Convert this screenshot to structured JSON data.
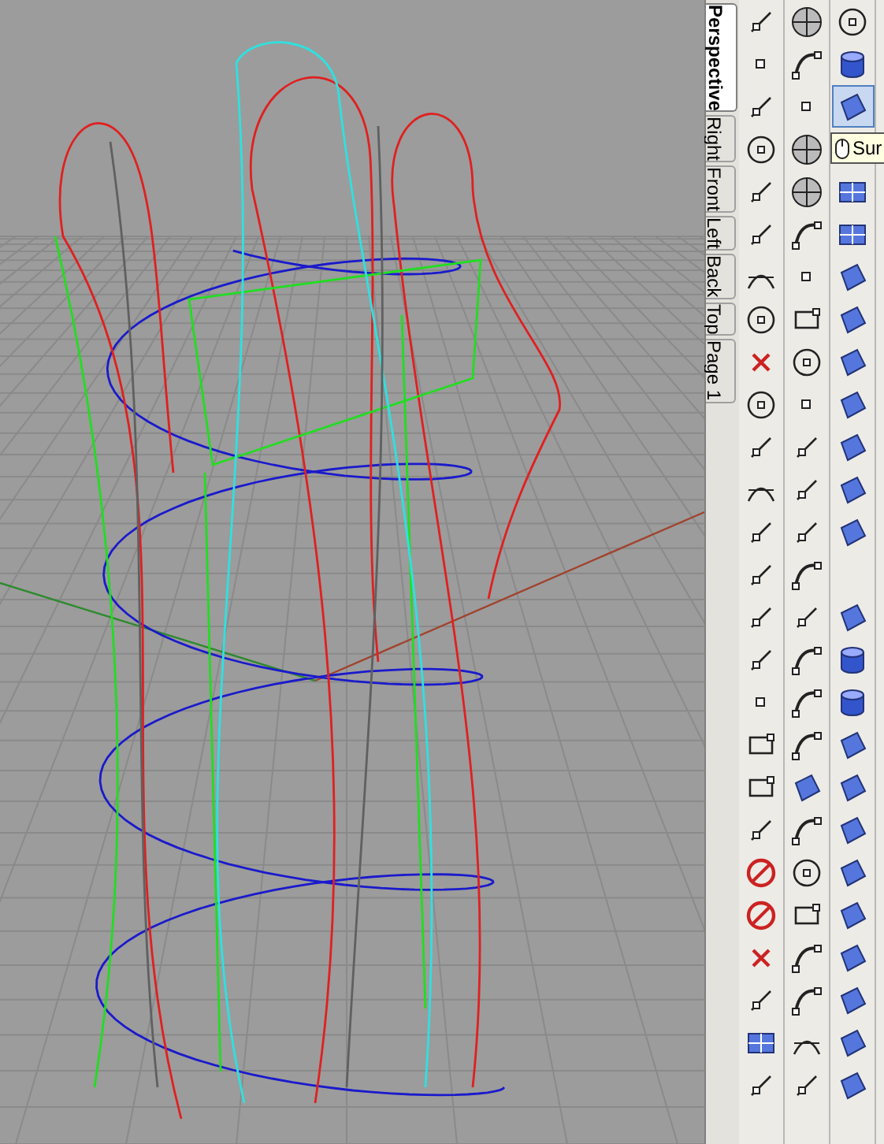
{
  "viewport_tabs": [
    {
      "label": "Perspective",
      "selected": true
    },
    {
      "label": "Right",
      "selected": false
    },
    {
      "label": "Front",
      "selected": false
    },
    {
      "label": "Left",
      "selected": false
    },
    {
      "label": "Back",
      "selected": false
    },
    {
      "label": "Top",
      "selected": false
    },
    {
      "label": "Page 1",
      "selected": false
    }
  ],
  "tooltip": {
    "text": "Sur"
  }
}
